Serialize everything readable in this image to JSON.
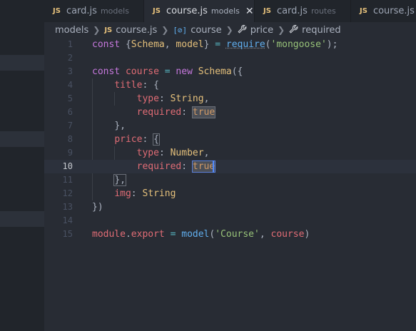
{
  "tabs": [
    {
      "name": "card.js",
      "desc": "models",
      "active": false
    },
    {
      "name": "course.js",
      "desc": "models",
      "active": true
    },
    {
      "name": "card.js",
      "desc": "routes",
      "active": false
    },
    {
      "name": "course.js",
      "desc": "",
      "active": false
    }
  ],
  "tab_icon_text": "JS",
  "breadcrumb": {
    "folder": "models",
    "file": "course.js",
    "symbol": "course",
    "property": "price",
    "field": "required"
  },
  "editor": {
    "current_line": 10,
    "lines": [
      {
        "n": "1"
      },
      {
        "n": "2"
      },
      {
        "n": "3"
      },
      {
        "n": "4"
      },
      {
        "n": "5"
      },
      {
        "n": "6"
      },
      {
        "n": "7"
      },
      {
        "n": "8"
      },
      {
        "n": "9"
      },
      {
        "n": "10"
      },
      {
        "n": "11"
      },
      {
        "n": "12"
      },
      {
        "n": "13"
      },
      {
        "n": "14"
      },
      {
        "n": "15"
      }
    ],
    "code": {
      "l1": {
        "kw": "const",
        "open": "{",
        "schema": "Schema",
        "comma": ",",
        "model": "model",
        "close": "}",
        "eq": "=",
        "req": "require",
        "paren_open": "(",
        "str": "'mongoose'",
        "paren_close": ");"
      },
      "l3": {
        "kw": "const",
        "name": "course",
        "eq": "=",
        "new": "new",
        "cls": "Schema",
        "open": "({"
      },
      "l4": {
        "key": "title",
        "colon": ":",
        "open": "{"
      },
      "l5": {
        "key": "type",
        "colon": ":",
        "val": "String",
        "comma": ","
      },
      "l6": {
        "key": "required",
        "colon": ":",
        "val": "true"
      },
      "l7": {
        "close": "},"
      },
      "l8": {
        "key": "price",
        "colon": ":",
        "open": "{"
      },
      "l9": {
        "key": "type",
        "colon": ":",
        "val": "Number",
        "comma": ","
      },
      "l10": {
        "key": "required",
        "colon": ":",
        "val": "true"
      },
      "l11": {
        "close": "},"
      },
      "l12": {
        "key": "img",
        "colon": ":",
        "val": "String"
      },
      "l13": {
        "close": "})"
      },
      "l15": {
        "mod": "module",
        "dot": ".",
        "exp": "export",
        "eq": "=",
        "fn": "model",
        "open": "(",
        "str": "'Course'",
        "comma": ",",
        "arg": "course",
        "close": ")"
      }
    }
  },
  "colors": {
    "background": "#282c34",
    "keyword": "#c678dd",
    "variable": "#e06c75",
    "type": "#e5c07b",
    "string": "#98c379",
    "function": "#61afef",
    "boolean": "#d19a66"
  }
}
